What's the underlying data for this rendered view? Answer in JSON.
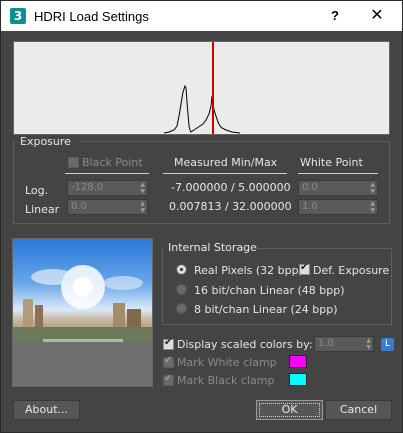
{
  "window": {
    "title": "HDRI Load Settings",
    "app_icon_text": "3",
    "help_label": "?",
    "close_label": "✕"
  },
  "exposure": {
    "group_label": "Exposure",
    "black_point_label": "Black Point",
    "measured_label": "Measured Min/Max",
    "white_point_label": "White Point",
    "row_log_label": "Log.",
    "row_linear_label": "Linear",
    "black_log_value": "-128.0",
    "black_linear_value": "0.0",
    "measured_log": "-7.000000 / 5.000000",
    "measured_linear": "0.007813 / 32.000000",
    "white_log_value": "0.0",
    "white_linear_value": "1.0"
  },
  "storage": {
    "group_label": "Internal Storage",
    "options": [
      {
        "label": "Real Pixels (32 bpp)",
        "selected": true
      },
      {
        "label": "16 bit/chan Linear (48 bpp)",
        "selected": false
      },
      {
        "label": "8 bit/chan Linear (24 bpp)",
        "selected": false
      }
    ],
    "def_exposure_label": "Def. Exposure"
  },
  "display": {
    "scaled_label": "Display scaled colors by:",
    "scaled_value": "1.0",
    "l_label": "L",
    "mark_white_label": "Mark White clamp",
    "mark_black_label": "Mark Black clamp",
    "white_clamp_color": "#ff00ff",
    "black_clamp_color": "#00ffff"
  },
  "buttons": {
    "about": "About...",
    "ok": "OK",
    "cancel": "Cancel"
  },
  "colors": {
    "window_bg": "#444444",
    "histogram_bg": "#ebebeb",
    "marker": "#cc0000"
  }
}
